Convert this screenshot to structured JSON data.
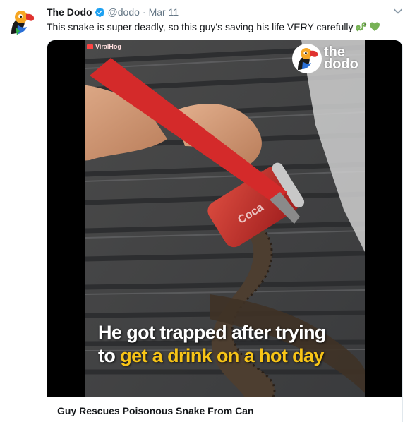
{
  "tweet": {
    "display_name": "The Dodo",
    "handle": "@dodo",
    "separator": "·",
    "date": "Mar 11",
    "text": "This snake is super deadly, so this guy's saving his life VERY carefully",
    "emojis": [
      "snake-emoji",
      "green-heart-emoji"
    ]
  },
  "card": {
    "video_watermark": "ViralHog",
    "brand_line1": "the",
    "brand_line2": "dodo",
    "caption_line1": "He got trapped after trying",
    "caption_line2_prefix": "to",
    "caption_line2_highlight": "get a drink on a hot day",
    "title": "Guy Rescues Poisonous Snake From Can"
  },
  "colors": {
    "verified_blue": "#1da1f2",
    "caption_highlight": "#f7c417",
    "muted_text": "#657786",
    "border": "#e1e8ed",
    "emoji_green": "#77b255"
  }
}
